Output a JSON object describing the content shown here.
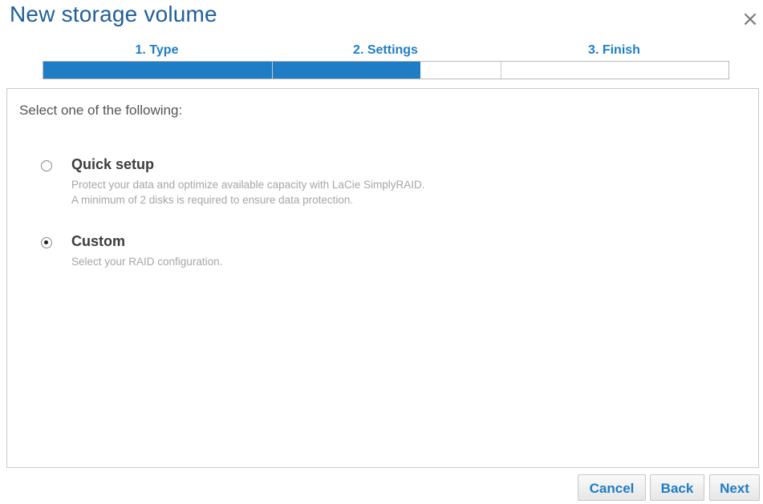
{
  "dialog": {
    "title": "New storage volume",
    "close_glyph": "×"
  },
  "steps": {
    "items": [
      {
        "label": "1. Type"
      },
      {
        "label": "2. Settings"
      },
      {
        "label": "3. Finish"
      }
    ],
    "progress_percent": 55
  },
  "main": {
    "prompt": "Select one of the following:",
    "options": [
      {
        "title": "Quick setup",
        "description_line1": "Protect your data and optimize available capacity with LaCie SimplyRAID.",
        "description_line2": "A minimum of 2 disks is required to ensure data protection.",
        "selected": false
      },
      {
        "title": "Custom",
        "description_line1": "Select your RAID configuration.",
        "selected": true
      }
    ]
  },
  "footer": {
    "cancel_label": "Cancel",
    "back_label": "Back",
    "next_label": "Next"
  },
  "colors": {
    "accent": "#1e7dc4",
    "title": "#1f5f9a"
  }
}
